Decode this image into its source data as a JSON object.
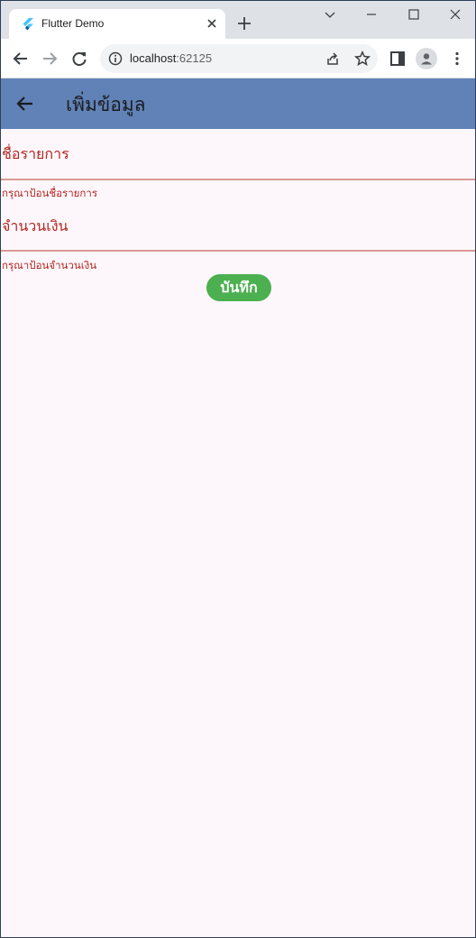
{
  "browser": {
    "tab_title": "Flutter Demo",
    "url_host": "localhost",
    "url_port": ":62125"
  },
  "icons": {
    "tab": [
      "flutter-icon",
      "close-icon",
      "plus-icon"
    ],
    "window": [
      "chevron-down-icon",
      "minimize-icon",
      "maximize-icon",
      "close-icon"
    ],
    "toolbar": [
      "back-icon",
      "forward-icon",
      "reload-icon",
      "info-icon",
      "share-icon",
      "star-icon",
      "sidepanel-icon",
      "avatar-icon",
      "menu-icon"
    ]
  },
  "app": {
    "title": "เพิ่มข้อมูล",
    "bar_color": "#6082b6",
    "error_color": "#b3261e",
    "background": "#fdf7fc"
  },
  "form": {
    "name_label": "ชื่อรายการ",
    "name_error": "กรุณาป้อนชื่อรายการ",
    "amount_label": "จำนวนเงิน",
    "amount_error": "กรุณาป้อนจำนวนเงิน",
    "save_label": "บันทึก",
    "save_color": "#4caf50"
  }
}
